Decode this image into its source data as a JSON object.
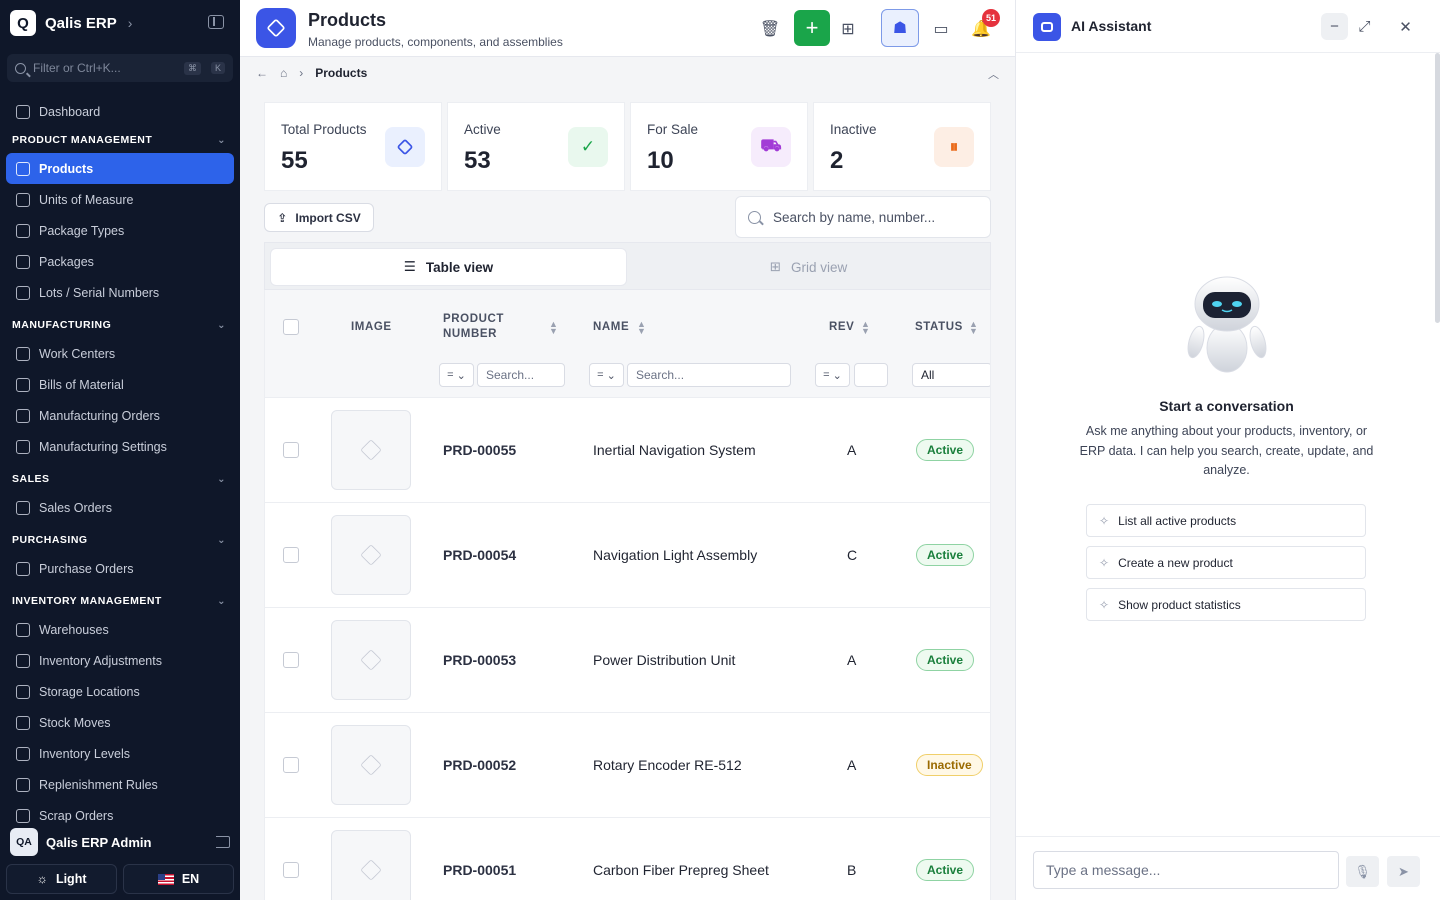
{
  "app": {
    "brand_letter": "Q",
    "brand_name": "Qalis ERP",
    "filter_placeholder": "Filter or Ctrl+K...",
    "filter_kbd_1": "⌘",
    "filter_kbd_2": "K"
  },
  "sidebar": {
    "dashboard": "Dashboard",
    "sections": [
      {
        "title": "PRODUCT MANAGEMENT",
        "items": [
          "Products",
          "Units of Measure",
          "Package Types",
          "Packages",
          "Lots / Serial Numbers"
        ]
      },
      {
        "title": "MANUFACTURING",
        "items": [
          "Work Centers",
          "Bills of Material",
          "Manufacturing Orders",
          "Manufacturing Settings"
        ]
      },
      {
        "title": "SALES",
        "items": [
          "Sales Orders"
        ]
      },
      {
        "title": "PURCHASING",
        "items": [
          "Purchase Orders"
        ]
      },
      {
        "title": "INVENTORY MANAGEMENT",
        "items": [
          "Warehouses",
          "Inventory Adjustments",
          "Storage Locations",
          "Stock Moves",
          "Inventory Levels",
          "Replenishment Rules",
          "Scrap Orders"
        ]
      }
    ],
    "user_initials": "QA",
    "user_name": "Qalis ERP Admin",
    "theme_label": "Light",
    "lang_label": "EN"
  },
  "header": {
    "title": "Products",
    "subtitle": "Manage products, components, and assemblies",
    "notification_count": "51",
    "breadcrumb_current": "Products",
    "add_symbol": "+"
  },
  "stats": [
    {
      "label": "Total Products",
      "value": "55",
      "icon": "cube-icon",
      "color": "#3b55e6",
      "bg": "#eaf0fe",
      "glyph": "⬡"
    },
    {
      "label": "Active",
      "value": "53",
      "icon": "check-circle-icon",
      "color": "#1aa54a",
      "bg": "#e9f8ee",
      "glyph": "✓"
    },
    {
      "label": "For Sale",
      "value": "10",
      "icon": "cart-icon",
      "color": "#a23bd6",
      "bg": "#f6ecfc",
      "glyph": "🛒"
    },
    {
      "label": "Inactive",
      "value": "2",
      "icon": "pause-circle-icon",
      "color": "#ea6a1a",
      "bg": "#fdeee4",
      "glyph": "⏸"
    }
  ],
  "toolbar": {
    "import_label": "Import CSV",
    "search_placeholder": "Search by name, number...",
    "table_view": "Table view",
    "grid_view": "Grid view"
  },
  "table": {
    "columns": {
      "image": "IMAGE",
      "product_number": "PRODUCT NUMBER",
      "name": "NAME",
      "rev": "REV",
      "status": "STATUS"
    },
    "filters": {
      "op": "=",
      "search_placeholder": "Search...",
      "status_value": "All"
    },
    "rows": [
      {
        "number": "PRD-00055",
        "name": "Inertial Navigation System",
        "rev": "A",
        "status": "Active"
      },
      {
        "number": "PRD-00054",
        "name": "Navigation Light Assembly",
        "rev": "C",
        "status": "Active"
      },
      {
        "number": "PRD-00053",
        "name": "Power Distribution Unit",
        "rev": "A",
        "status": "Active"
      },
      {
        "number": "PRD-00052",
        "name": "Rotary Encoder RE-512",
        "rev": "A",
        "status": "Inactive"
      },
      {
        "number": "PRD-00051",
        "name": "Carbon Fiber Prepreg Sheet",
        "rev": "B",
        "status": "Active"
      }
    ]
  },
  "ai": {
    "title": "AI Assistant",
    "start_title": "Start a conversation",
    "description": "Ask me anything about your products, inventory, or ERP data. I can help you search, create, update, and analyze.",
    "suggestions": [
      "List all active products",
      "Create a new product",
      "Show product statistics"
    ],
    "input_placeholder": "Type a message..."
  }
}
